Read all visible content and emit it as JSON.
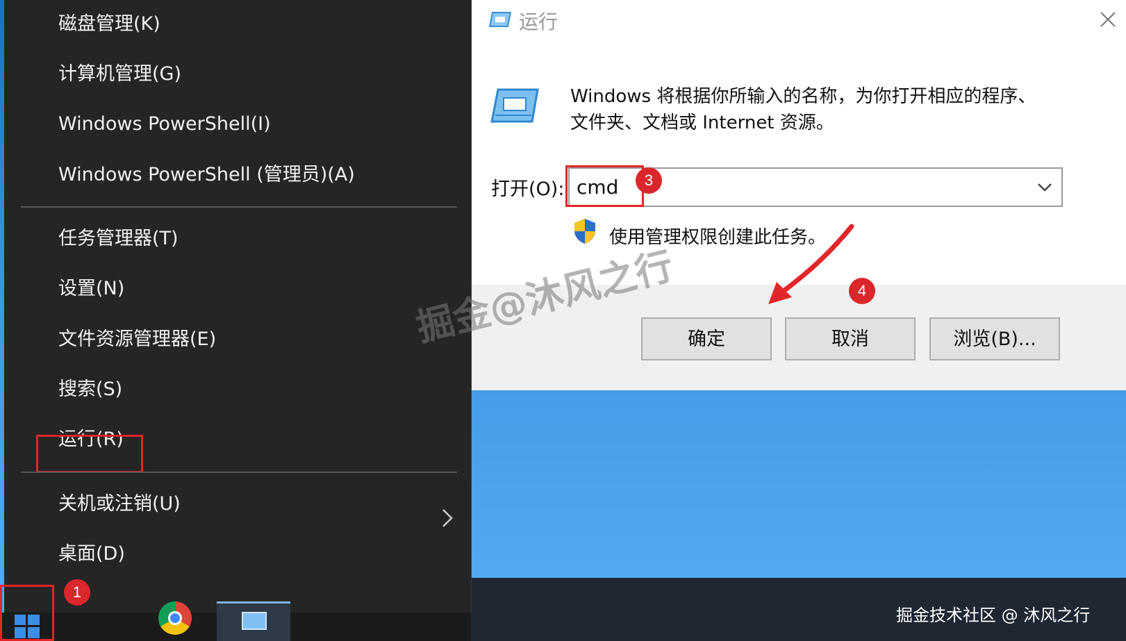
{
  "winx_menu": {
    "items": [
      {
        "label": "磁盘管理(K)"
      },
      {
        "label": "计算机管理(G)"
      },
      {
        "label": "Windows PowerShell(I)"
      },
      {
        "label": "Windows PowerShell (管理员)(A)"
      },
      {
        "label": "任务管理器(T)"
      },
      {
        "label": "设置(N)"
      },
      {
        "label": "文件资源管理器(E)"
      },
      {
        "label": "搜索(S)"
      },
      {
        "label": "运行(R)"
      },
      {
        "label": "关机或注销(U)"
      },
      {
        "label": "桌面(D)"
      }
    ]
  },
  "run_dialog": {
    "title": "运行",
    "description_line1": "Windows 将根据你所输入的名称，为你打开相应的程序、",
    "description_line2": "文件夹、文档或 Internet 资源。",
    "open_label": "打开(O):",
    "open_value": "cmd",
    "admin_note": "使用管理权限创建此任务。",
    "buttons": {
      "ok": "确定",
      "cancel": "取消",
      "browse": "浏览(B)..."
    }
  },
  "annotations": {
    "badge_1": "1",
    "badge_3": "3",
    "badge_4": "4",
    "highlight_color": "#e2262a"
  },
  "watermarks": {
    "center": "掘金@沐风之行",
    "corner": "掘金技术社区 @ 沐风之行"
  },
  "icons": [
    "windows-start-icon",
    "chrome-icon",
    "run-app-icon",
    "shield-icon",
    "close-icon",
    "chevron-right-icon",
    "chevron-down-icon"
  ]
}
